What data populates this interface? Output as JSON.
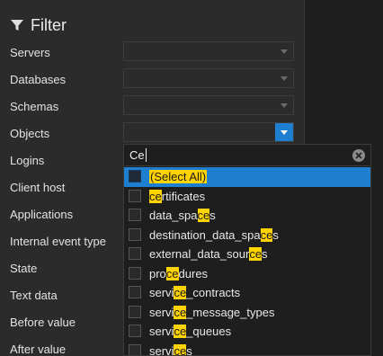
{
  "filter": {
    "title": "Filter",
    "icon": "funnel-icon"
  },
  "rows": [
    {
      "label": "Servers"
    },
    {
      "label": "Databases"
    },
    {
      "label": "Schemas"
    },
    {
      "label": "Objects"
    },
    {
      "label": "Logins"
    },
    {
      "label": "Client host"
    },
    {
      "label": "Applications"
    },
    {
      "label": "Internal event type"
    },
    {
      "label": "State"
    },
    {
      "label": "Text data"
    },
    {
      "label": "Before value"
    },
    {
      "label": "After value"
    }
  ],
  "objects_dropdown": {
    "search_value": "Ce",
    "items": [
      {
        "pre": "",
        "hl": "(Select All)",
        "post": "",
        "selected": true
      },
      {
        "pre": "",
        "hl": "ce",
        "post": "rtificates",
        "selected": false
      },
      {
        "pre": "data_spa",
        "hl": "ce",
        "post": "s",
        "selected": false
      },
      {
        "pre": "destination_data_spa",
        "hl": "ce",
        "post": "s",
        "selected": false
      },
      {
        "pre": "external_data_sour",
        "hl": "ce",
        "post": "s",
        "selected": false
      },
      {
        "pre": "pro",
        "hl": "ce",
        "post": "dures",
        "selected": false
      },
      {
        "pre": "servi",
        "hl": "ce",
        "post": "_contracts",
        "selected": false
      },
      {
        "pre": "servi",
        "hl": "ce",
        "post": "_message_types",
        "selected": false
      },
      {
        "pre": "servi",
        "hl": "ce",
        "post": "_queues",
        "selected": false
      },
      {
        "pre": "servi",
        "hl": "ce",
        "post": "s",
        "selected": false
      }
    ]
  },
  "colors": {
    "accent": "#1e7fd1",
    "highlight": "#ffd400",
    "background": "#2b2b2b"
  }
}
